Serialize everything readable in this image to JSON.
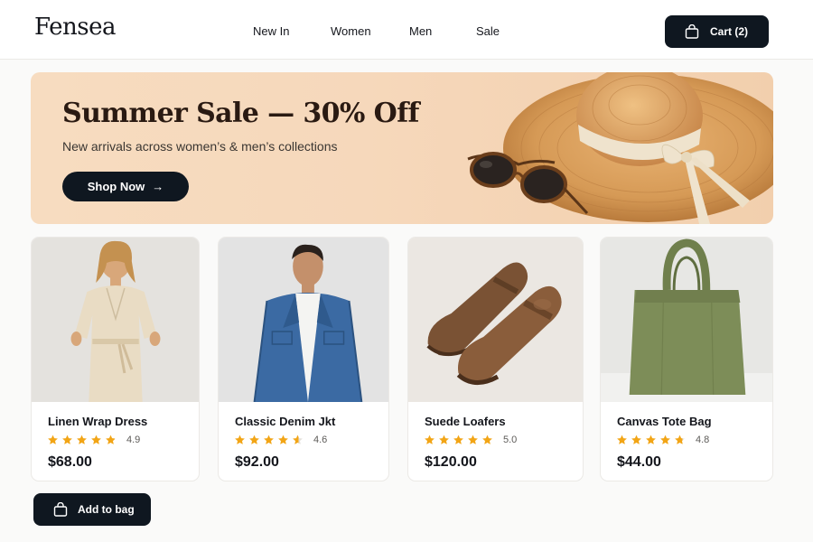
{
  "brand": {
    "logo": "Fensea"
  },
  "nav": {
    "items": [
      "New In",
      "Women",
      "Men",
      "Sale"
    ]
  },
  "cart": {
    "label": "Cart (2)",
    "icon": "shopping-bag-icon"
  },
  "hero": {
    "title": "Summer Sale — 30% Off",
    "subtitle": "New arrivals across women’s & men’s collections",
    "cta": "Shop Now",
    "cta_arrow": "→"
  },
  "products": [
    {
      "name": "Linen Wrap Dress",
      "rating": 4.9,
      "rating_text": "4.9",
      "price": "$68.00"
    },
    {
      "name": "Classic Denim Jkt",
      "rating": 4.6,
      "rating_text": "4.6",
      "price": "$92.00"
    },
    {
      "name": "Suede Loafers",
      "rating": 5.0,
      "rating_text": "5.0",
      "price": "$120.00"
    },
    {
      "name": "Canvas Tote Bag",
      "rating": 4.8,
      "rating_text": "4.8",
      "price": "$44.00"
    }
  ],
  "add_to_bag": {
    "label": "Add to bag",
    "icon": "shopping-bag-icon"
  },
  "colors": {
    "primary_dark": "#0f1720",
    "hero_bg": "#f6d8bb",
    "star": "#f2a516",
    "star_empty": "#e4e1dc"
  }
}
